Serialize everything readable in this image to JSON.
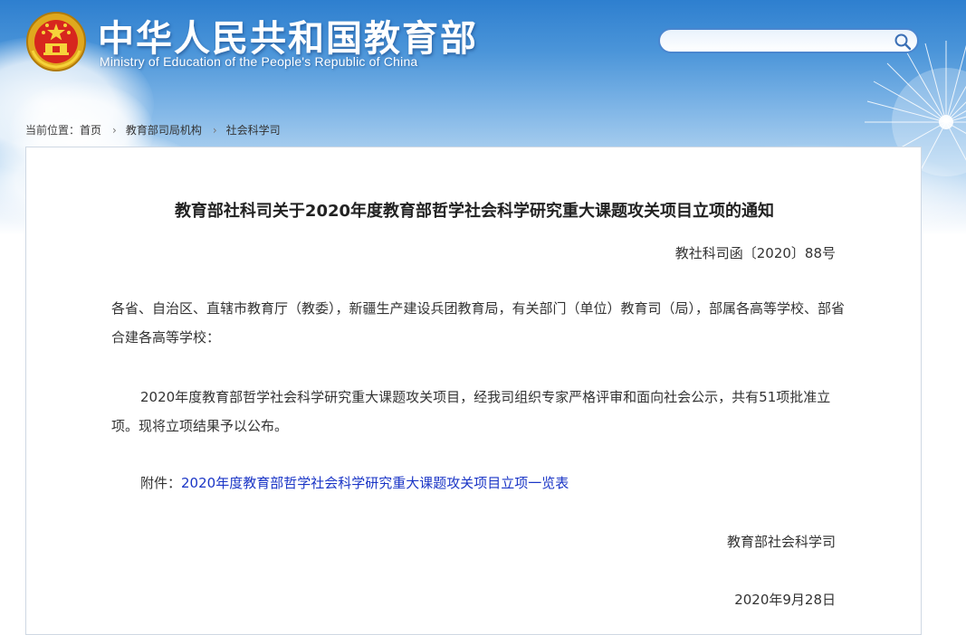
{
  "header": {
    "title_cn": "中华人民共和国教育部",
    "title_en": "Ministry of Education of the People's Republic of China",
    "emblem_icon": "national-emblem-icon",
    "colors": {
      "sky_top": "#2e7fcf",
      "title_text": "#ffffff",
      "search_border": "#4a86cf"
    }
  },
  "search": {
    "value": "",
    "placeholder": "",
    "icon": "search-icon"
  },
  "breadcrumb": {
    "prefix": "当前位置：",
    "items": [
      "首页",
      "教育部司局机构",
      "社会科学司"
    ],
    "separator": "›"
  },
  "article": {
    "title": "教育部社科司关于2020年度教育部哲学社会科学研究重大课题攻关项目立项的通知",
    "doc_number": "教社科司函〔2020〕88号",
    "addressee": "各省、自治区、直辖市教育厅（教委），新疆生产建设兵团教育局，有关部门（单位）教育司（局），部属各高等学校、部省合建各高等学校：",
    "body": "2020年度教育部哲学社会科学研究重大课题攻关项目，经我司组织专家严格评审和面向社会公示，共有51项批准立项。现将立项结果予以公布。",
    "attachment_label": "附件：",
    "attachment_link": "2020年度教育部哲学社会科学研究重大课题攻关项目立项一览表",
    "link_color": "#1a35c6",
    "signature_org": "教育部社会科学司",
    "signature_date": "2020年9月28日"
  }
}
